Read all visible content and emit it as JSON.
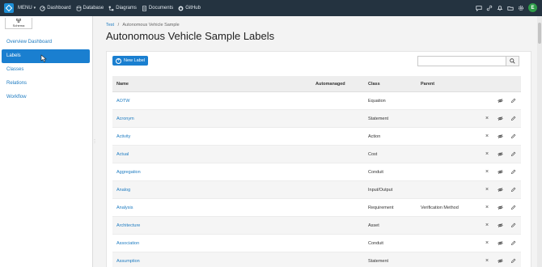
{
  "topbar": {
    "menu_label": "MENU",
    "nav": [
      {
        "label": "Dashboard",
        "icon": "dashboard-icon"
      },
      {
        "label": "Database",
        "icon": "database-icon"
      },
      {
        "label": "Diagrams",
        "icon": "diagrams-icon"
      },
      {
        "label": "Documents",
        "icon": "documents-icon"
      },
      {
        "label": "GitHub",
        "icon": "github-icon"
      }
    ],
    "user_initial": "E"
  },
  "sidebar": {
    "schema_label": "Schema",
    "items": [
      {
        "label": "Overview Dashboard",
        "active": false
      },
      {
        "label": "Labels",
        "active": true
      },
      {
        "label": "Classes",
        "active": false
      },
      {
        "label": "Relations",
        "active": false
      },
      {
        "label": "Workflow",
        "active": false
      }
    ]
  },
  "breadcrumb": {
    "root": "Test",
    "separator": "/",
    "current": "Autonomous Vehicle Sample"
  },
  "page_title": "Autonomous Vehicle Sample Labels",
  "new_label_button": "New Label",
  "search": {
    "placeholder": "",
    "value": ""
  },
  "table": {
    "columns": {
      "name": "Name",
      "automanaged": "Automanaged",
      "class": "Class",
      "parent": "Parent"
    },
    "rows": [
      {
        "name": "AOTW",
        "automanaged": "",
        "class": "Equation",
        "parent": "",
        "deletable": false
      },
      {
        "name": "Acronym",
        "automanaged": "",
        "class": "Statement",
        "parent": "",
        "deletable": true
      },
      {
        "name": "Activity",
        "automanaged": "",
        "class": "Action",
        "parent": "",
        "deletable": true
      },
      {
        "name": "Actual",
        "automanaged": "",
        "class": "Cost",
        "parent": "",
        "deletable": true
      },
      {
        "name": "Aggregation",
        "automanaged": "",
        "class": "Conduit",
        "parent": "",
        "deletable": true
      },
      {
        "name": "Analog",
        "automanaged": "",
        "class": "Input/Output",
        "parent": "",
        "deletable": true
      },
      {
        "name": "Analysis",
        "automanaged": "",
        "class": "Requirement",
        "parent": "Verification Method",
        "deletable": true
      },
      {
        "name": "Architecture",
        "automanaged": "",
        "class": "Asset",
        "parent": "",
        "deletable": true
      },
      {
        "name": "Association",
        "automanaged": "",
        "class": "Conduit",
        "parent": "",
        "deletable": true
      },
      {
        "name": "Assumption",
        "automanaged": "",
        "class": "Statement",
        "parent": "",
        "deletable": true
      }
    ]
  },
  "colors": {
    "topbar": "#243340",
    "accent": "#1a7fd0",
    "link": "#1d7bc1",
    "avatar": "#2e9b48"
  }
}
